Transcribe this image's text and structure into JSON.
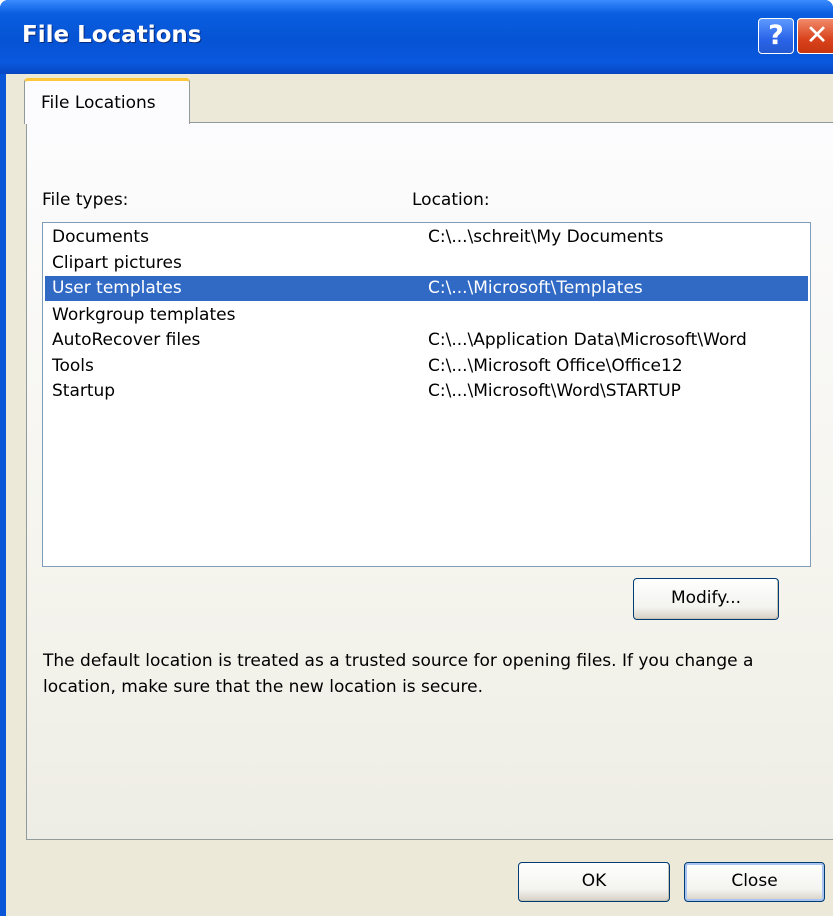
{
  "window": {
    "title": "File Locations",
    "help_label": "?",
    "close_label": "✕"
  },
  "tabs": [
    {
      "label": "File Locations",
      "active": true
    }
  ],
  "list": {
    "header_file_types": "File types:",
    "header_location": "Location:",
    "rows": [
      {
        "type": "Documents",
        "location": "C:\\...\\schreit\\My Documents",
        "selected": false
      },
      {
        "type": "Clipart pictures",
        "location": "",
        "selected": false
      },
      {
        "type": "User templates",
        "location": "C:\\...\\Microsoft\\Templates",
        "selected": true
      },
      {
        "type": "Workgroup templates",
        "location": "",
        "selected": false
      },
      {
        "type": "AutoRecover files",
        "location": "C:\\...\\Application Data\\Microsoft\\Word",
        "selected": false
      },
      {
        "type": "Tools",
        "location": "C:\\...\\Microsoft Office\\Office12",
        "selected": false
      },
      {
        "type": "Startup",
        "location": "C:\\...\\Microsoft\\Word\\STARTUP",
        "selected": false
      }
    ]
  },
  "buttons": {
    "modify": "Modify...",
    "ok": "OK",
    "close": "Close"
  },
  "info_text": "The default location is treated as a trusted source for opening files. If you change a location, make sure that the new location is secure.",
  "colors": {
    "titlebar": "#0653d5",
    "selection": "#316ac5",
    "dialog_face": "#ece9d8"
  }
}
